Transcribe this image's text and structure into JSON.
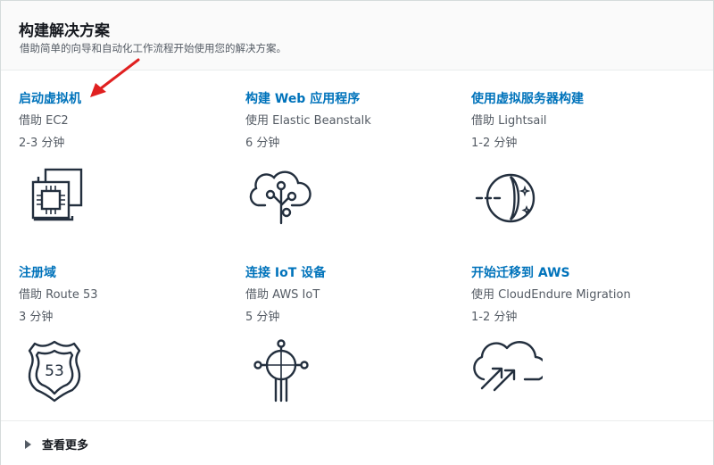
{
  "header": {
    "title": "构建解决方案",
    "subtitle": "借助简单的向导和自动化工作流程开始使用您的解决方案。"
  },
  "cards": [
    {
      "title": "启动虚拟机",
      "subtitle": "借助 EC2",
      "time": "2-3 分钟",
      "icon": "ec2-chip-icon"
    },
    {
      "title": "构建 Web 应用程序",
      "subtitle": "使用 Elastic Beanstalk",
      "time": "6 分钟",
      "icon": "cloud-tree-icon"
    },
    {
      "title": "使用虚拟服务器构建",
      "subtitle": "借助 Lightsail",
      "time": "1-2 分钟",
      "icon": "lightsail-icon"
    },
    {
      "title": "注册域",
      "subtitle": "借助 Route 53",
      "time": "3 分钟",
      "icon": "route53-shield-icon"
    },
    {
      "title": "连接 IoT 设备",
      "subtitle": "借助 AWS IoT",
      "time": "5 分钟",
      "icon": "iot-network-icon"
    },
    {
      "title": "开始迁移到 AWS",
      "subtitle": "使用 CloudEndure Migration",
      "time": "1-2 分钟",
      "icon": "cloud-migration-icon"
    }
  ],
  "route53_badge": "53",
  "footer": {
    "more_label": "查看更多"
  },
  "colors": {
    "link": "#0073bb",
    "icon": "#232f3e",
    "annotation_arrow": "#e02020"
  }
}
